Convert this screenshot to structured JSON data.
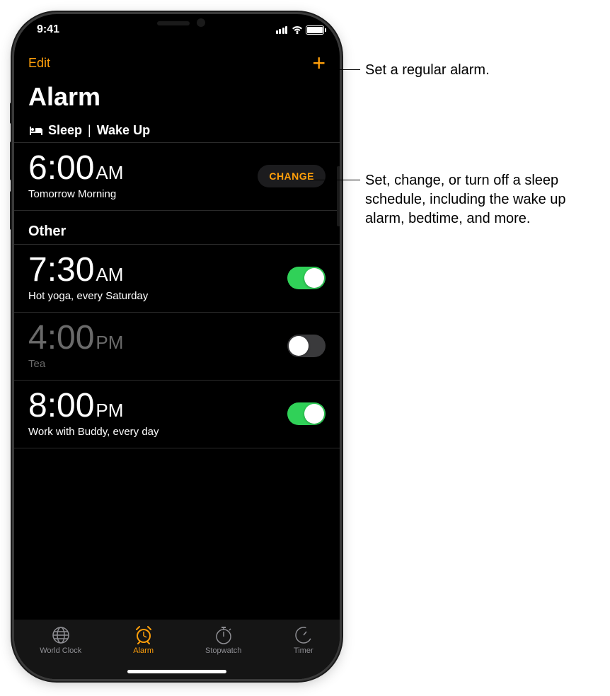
{
  "status": {
    "time": "9:41"
  },
  "navbar": {
    "edit_label": "Edit",
    "add_label": "+"
  },
  "page_title": "Alarm",
  "sleep_section": {
    "label_sleep": "Sleep",
    "divider": "|",
    "label_wakeup": "Wake Up",
    "time": "6:00",
    "ampm": "AM",
    "subtitle": "Tomorrow Morning",
    "change_label": "CHANGE"
  },
  "other_section": {
    "header": "Other",
    "alarms": [
      {
        "time": "7:30",
        "ampm": "AM",
        "label": "Hot yoga, every Saturday",
        "enabled": true
      },
      {
        "time": "4:00",
        "ampm": "PM",
        "label": "Tea",
        "enabled": false
      },
      {
        "time": "8:00",
        "ampm": "PM",
        "label": "Work with Buddy, every day",
        "enabled": true
      }
    ]
  },
  "tabs": [
    {
      "label": "World Clock",
      "active": false
    },
    {
      "label": "Alarm",
      "active": true
    },
    {
      "label": "Stopwatch",
      "active": false
    },
    {
      "label": "Timer",
      "active": false
    }
  ],
  "callouts": {
    "c1": "Set a regular alarm.",
    "c2": "Set, change, or turn off a sleep schedule, including the wake up alarm, bedtime, and more."
  }
}
